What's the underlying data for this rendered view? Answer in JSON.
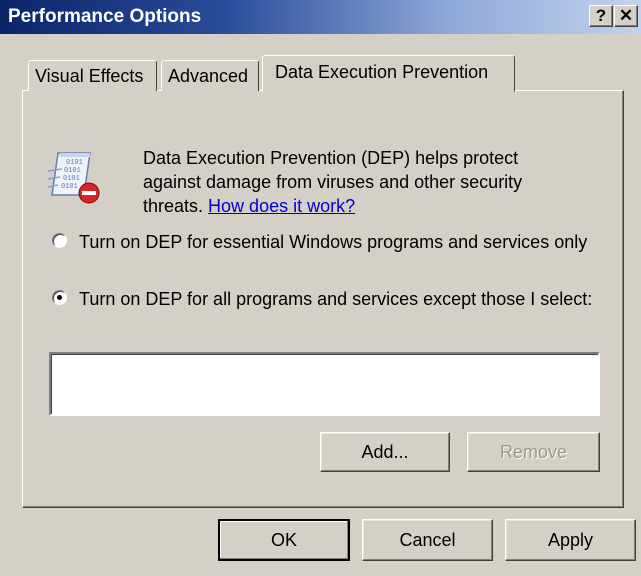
{
  "window": {
    "title": "Performance Options",
    "help_button": "?",
    "close_button": "✕"
  },
  "tabs": [
    {
      "label": "Visual Effects",
      "active": false
    },
    {
      "label": "Advanced",
      "active": false
    },
    {
      "label": "Data Execution Prevention",
      "active": true
    }
  ],
  "dep": {
    "description": "Data Execution Prevention (DEP) helps protect against damage from viruses and other security threats.",
    "link": "How does it work?",
    "icon": "dep-shield-icon",
    "options": [
      {
        "label": "Turn on DEP for essential Windows programs and services only",
        "checked": false
      },
      {
        "label": "Turn on DEP for all programs and services except those I select:",
        "checked": true
      }
    ],
    "exceptions_list": [],
    "add_button": "Add...",
    "remove_button": "Remove",
    "remove_enabled": false
  },
  "footer": {
    "ok": "OK",
    "cancel": "Cancel",
    "apply": "Apply"
  }
}
